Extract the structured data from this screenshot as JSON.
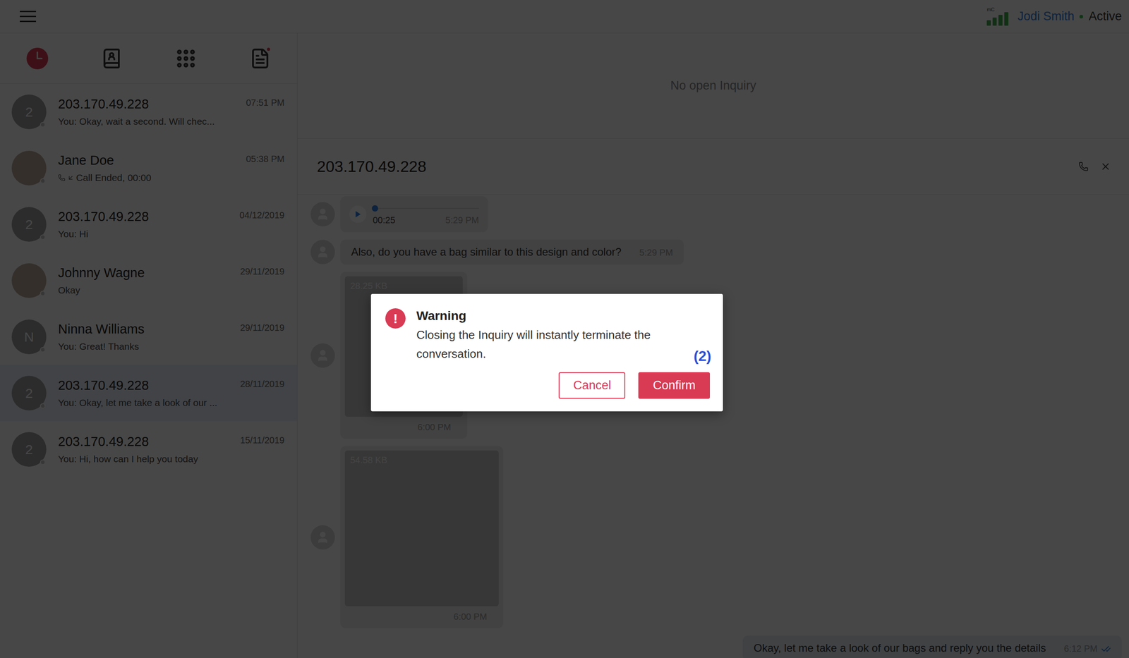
{
  "user": {
    "network_label": "mC",
    "signal_level": 1,
    "name": "Jodi Smith",
    "status": "Active",
    "status_color": "#3fb950"
  },
  "tabs": [
    {
      "kind": "history",
      "selected": true,
      "badge": false
    },
    {
      "kind": "contacts",
      "selected": false,
      "badge": false
    },
    {
      "kind": "dialpad",
      "selected": false,
      "badge": false
    },
    {
      "kind": "notes",
      "selected": false,
      "badge": true
    }
  ],
  "conversations": [
    {
      "name": "203.170.49.228",
      "preview": "You: Okay, wait a second. Will chec...",
      "time": "07:51 PM",
      "avatar": "2",
      "kind": "initial",
      "preview_kind": "text",
      "selected": false
    },
    {
      "name": "Jane Doe",
      "preview": "Call Ended, 00:00",
      "time": "05:38 PM",
      "avatar": "",
      "kind": "photo",
      "preview_kind": "call",
      "selected": false
    },
    {
      "name": "203.170.49.228",
      "preview": "You: Hi",
      "time": "04/12/2019",
      "avatar": "2",
      "kind": "initial",
      "preview_kind": "text",
      "selected": false
    },
    {
      "name": "Johnny Wagne",
      "preview": "Okay",
      "time": "29/11/2019",
      "avatar": "",
      "kind": "photo",
      "preview_kind": "text",
      "selected": false
    },
    {
      "name": "Ninna Williams",
      "preview": "You: Great! Thanks",
      "time": "29/11/2019",
      "avatar": "N",
      "kind": "initial",
      "preview_kind": "text",
      "selected": false
    },
    {
      "name": "203.170.49.228",
      "preview": "You: Okay, let me take a look of our ...",
      "time": "28/11/2019",
      "avatar": "2",
      "kind": "initial",
      "preview_kind": "text",
      "selected": true
    },
    {
      "name": "203.170.49.228",
      "preview": "You: Hi, how can I help you today",
      "time": "15/11/2019",
      "avatar": "2",
      "kind": "initial",
      "preview_kind": "text",
      "selected": false
    }
  ],
  "inquiry": {
    "text": "No open Inquiry"
  },
  "chat": {
    "title": "203.170.49.228",
    "messages": [
      {
        "kind": "audio",
        "direction": "in",
        "duration": "00:25",
        "time": "5:29 PM",
        "level": 0
      },
      {
        "kind": "text",
        "direction": "in",
        "text": "Also, do you have a bag similar to this design and color?",
        "time": "5:29 PM"
      },
      {
        "kind": "image",
        "direction": "in",
        "size": "28.25 KB",
        "time": "6:00 PM"
      },
      {
        "kind": "image",
        "direction": "in",
        "size": "54.58 KB",
        "time": "6:00 PM"
      },
      {
        "kind": "text",
        "direction": "out",
        "text": "Okay, let me take a look of our bags and reply you the details",
        "time": "6:12 PM",
        "read": true
      }
    ]
  },
  "dialog": {
    "icon": "!",
    "title": "Warning",
    "message": "Closing the Inquiry will instantly terminate the conversation.",
    "marker": "(2)",
    "buttons": [
      {
        "label": "Cancel",
        "kind": "secondary"
      },
      {
        "label": "Confirm",
        "kind": "primary"
      }
    ]
  }
}
